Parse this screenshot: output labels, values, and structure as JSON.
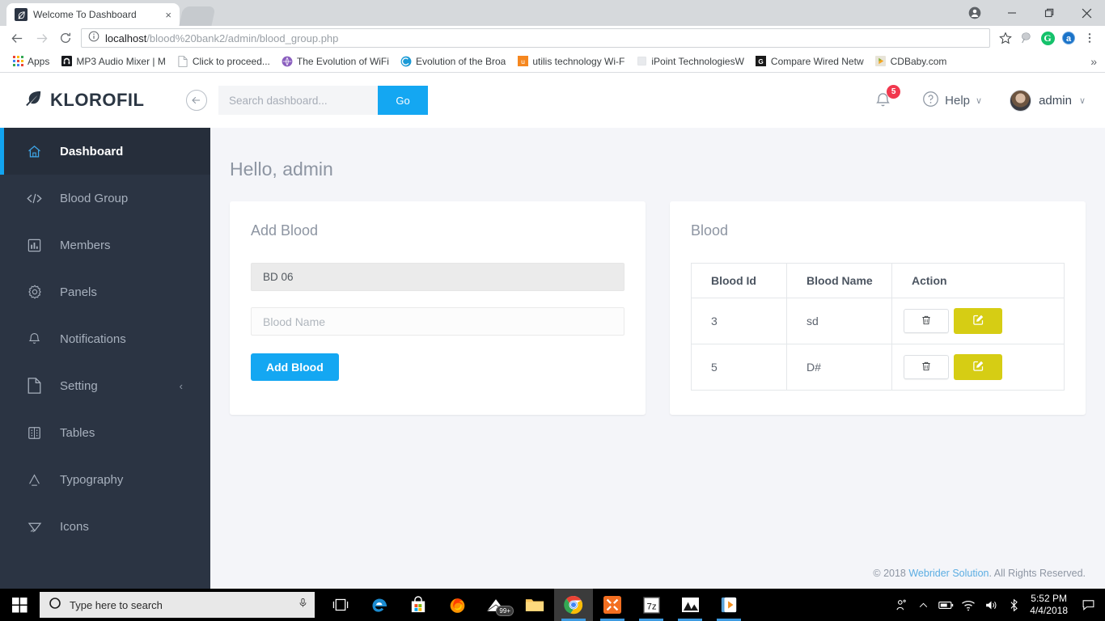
{
  "browser": {
    "tab_title": "Welcome To Dashboard",
    "tab_close": "×",
    "url_host": "localhost",
    "url_path": "/blood%20bank2/admin/blood_group.php",
    "bookmarks": [
      {
        "label": "Apps",
        "icon": "apps-grid-icon"
      },
      {
        "label": "MP3 Audio Mixer | M",
        "icon": "mp3-audio-mixer-icon"
      },
      {
        "label": "Click to proceed...",
        "icon": "page-icon"
      },
      {
        "label": "The Evolution of WiFi",
        "icon": "purple-globe-icon"
      },
      {
        "label": "Evolution of the Broa",
        "icon": "blue-swirl-icon"
      },
      {
        "label": "utilis technology Wi-F",
        "icon": "orange-u-icon"
      },
      {
        "label": "iPoint TechnologiesW",
        "icon": "blank-page-icon"
      },
      {
        "label": "Compare Wired Netw",
        "icon": "google-g-icon"
      },
      {
        "label": "CDBaby.com",
        "icon": "cdbaby-icon"
      }
    ],
    "bookmarks_overflow": "»",
    "extensions": [
      {
        "name": "pin-extension-icon",
        "label": ""
      },
      {
        "name": "grammarly-icon",
        "label": "G"
      },
      {
        "name": "adblock-icon",
        "label": "a"
      }
    ]
  },
  "app": {
    "brand": "KLOROFIL",
    "search": {
      "placeholder": "Search dashboard...",
      "value": "",
      "button": "Go"
    },
    "notifications_count": "5",
    "help_label": "Help",
    "user_label": "admin",
    "caret": "∨"
  },
  "sidebar": {
    "items": [
      {
        "label": "Dashboard",
        "icon": "home-icon",
        "active": true
      },
      {
        "label": "Blood Group",
        "icon": "code-icon",
        "active": false
      },
      {
        "label": "Members",
        "icon": "bar-chart-icon",
        "active": false
      },
      {
        "label": "Panels",
        "icon": "gear-icon",
        "active": false
      },
      {
        "label": "Notifications",
        "icon": "bell-icon",
        "active": false
      },
      {
        "label": "Setting",
        "icon": "file-icon",
        "active": false,
        "caret": "‹"
      },
      {
        "label": "Tables",
        "icon": "table-icon",
        "active": false
      },
      {
        "label": "Typography",
        "icon": "letter-a-icon",
        "active": false
      },
      {
        "label": "Icons",
        "icon": "diamond-icon",
        "active": false
      }
    ]
  },
  "main": {
    "greeting": "Hello, admin",
    "add_panel": {
      "title": "Add Blood",
      "blood_id_value": "BD 06",
      "blood_name_placeholder": "Blood Name",
      "blood_name_value": "",
      "submit_label": "Add Blood"
    },
    "table_panel": {
      "title": "Blood",
      "columns": [
        "Blood Id",
        "Blood Name",
        "Action"
      ],
      "rows": [
        {
          "id": "3",
          "name": "sd"
        },
        {
          "id": "5",
          "name": "D#"
        }
      ],
      "delete_icon": "trash-icon",
      "edit_icon": "edit-square-icon"
    },
    "footer": {
      "prefix": "© 2018 ",
      "link": "Webrider Solution",
      "suffix": ". All Rights Reserved."
    }
  },
  "taskbar": {
    "search_placeholder": "Type here to search",
    "time": "5:52 PM",
    "date": "4/4/2018",
    "apps": [
      {
        "name": "task-view-icon"
      },
      {
        "name": "edge-icon"
      },
      {
        "name": "microsoft-store-icon"
      },
      {
        "name": "firefox-icon"
      },
      {
        "name": "mail-icon",
        "badge": "99+"
      },
      {
        "name": "file-explorer-icon"
      },
      {
        "name": "chrome-icon"
      },
      {
        "name": "xampp-icon"
      },
      {
        "name": "7zip-icon"
      },
      {
        "name": "photos-icon"
      },
      {
        "name": "media-player-icon"
      }
    ]
  },
  "colors": {
    "accent_blue": "#14a7f2",
    "sidebar_bg": "#2b3443",
    "edit_yellow": "#d6cd14",
    "badge_red": "#f1384e"
  }
}
